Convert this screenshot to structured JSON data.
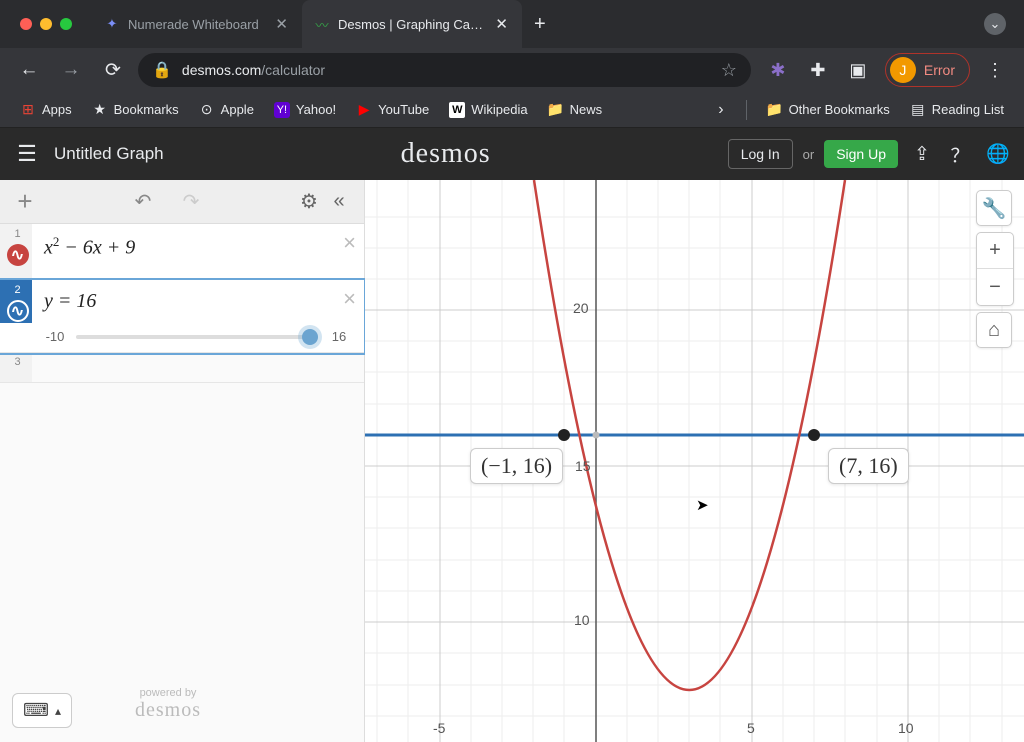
{
  "browser": {
    "tabs": [
      {
        "title": "Numerade Whiteboard",
        "icon": "✦"
      },
      {
        "title": "Desmos | Graphing Calculator",
        "icon": "📈"
      }
    ],
    "new_tab": "+",
    "url": {
      "host": "desmos.com",
      "path": "/calculator"
    },
    "avatar_letter": "J",
    "avatar_label": "Error"
  },
  "bookmarks": {
    "apps": "Apps",
    "items": [
      "Bookmarks",
      "Apple",
      "Yahoo!",
      "YouTube",
      "Wikipedia",
      "News"
    ],
    "other": "Other Bookmarks",
    "reading": "Reading List"
  },
  "desmos": {
    "graph_title": "Untitled Graph",
    "logo": "desmos",
    "login": "Log In",
    "or": "or",
    "signup": "Sign Up"
  },
  "expressions": {
    "row1": {
      "num": "1",
      "latex": "x² − 6x + 9"
    },
    "row2": {
      "num": "2",
      "latex": "y = 16",
      "slider_min": "-10",
      "slider_max": "16"
    },
    "row3": {
      "num": "3"
    }
  },
  "powered": {
    "by": "powered by",
    "logo": "desmos"
  },
  "graph_labels": {
    "axis_y_20": "20",
    "axis_y_15": "15",
    "axis_y_10": "10",
    "axis_x_m5": "-5",
    "axis_x_5": "5",
    "axis_x_10": "10",
    "pt1": "(−1, 16)",
    "pt2": "(7, 16)"
  },
  "chart_data": {
    "type": "line",
    "title": "",
    "xlabel": "",
    "ylabel": "",
    "xlim": [
      -8,
      12
    ],
    "ylim": [
      6.5,
      24.5
    ],
    "series": [
      {
        "name": "x^2 - 6x + 9",
        "color": "#c74440",
        "x": [
          -1.5,
          -1,
          0,
          1,
          2,
          3,
          4,
          5,
          6,
          7,
          7.5
        ],
        "y": [
          20.25,
          16,
          9,
          4,
          1,
          0,
          1,
          4,
          9,
          16,
          20.25
        ]
      },
      {
        "name": "y = 16",
        "color": "#2d70b3",
        "x": [
          -8,
          12
        ],
        "y": [
          16,
          16
        ]
      }
    ],
    "intersections": [
      {
        "x": -1,
        "y": 16
      },
      {
        "x": 7,
        "y": 16
      }
    ],
    "x_ticks": [
      -5,
      0,
      5,
      10
    ],
    "y_ticks": [
      10,
      15,
      20
    ]
  }
}
